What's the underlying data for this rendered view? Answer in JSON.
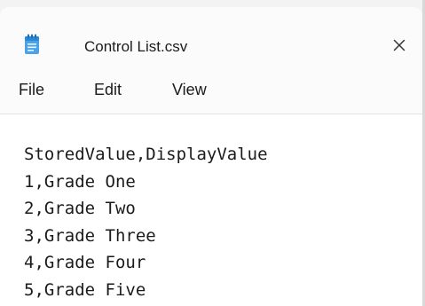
{
  "tab": {
    "icon": "notepad-file-icon",
    "title": "Control List.csv",
    "close_glyph": "✕"
  },
  "menu": {
    "items": [
      "File",
      "Edit",
      "View"
    ]
  },
  "editor": {
    "lines": [
      "StoredValue,DisplayValue",
      "1,Grade One",
      "2,Grade Two",
      "3,Grade Three",
      "4,Grade Four",
      "5,Grade Five"
    ]
  },
  "colors": {
    "icon_accent": "#2b88d8",
    "text": "#1b1b1b",
    "background": "#ffffff"
  }
}
